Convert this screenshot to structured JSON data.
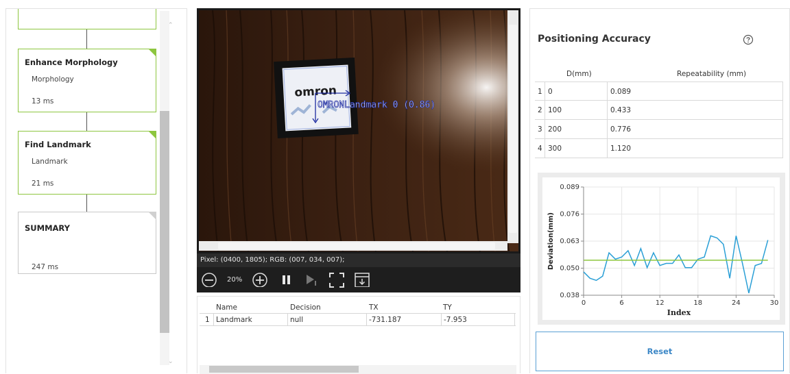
{
  "flow": {
    "cards": [
      {
        "title": "",
        "sub": "",
        "time": ""
      },
      {
        "title": "Enhance Morphology",
        "sub": "Morphology",
        "time": "13 ms"
      },
      {
        "title": "Find Landmark",
        "sub": "Landmark",
        "time": "21 ms"
      },
      {
        "title": "SUMMARY",
        "sub": "",
        "time": "247 ms"
      }
    ]
  },
  "viewer": {
    "logo_text": "omron",
    "overlay_label": "OMRONLandmark 0 (0.86)",
    "pixel_info": "Pixel: (0400, 1805); RGB: (007, 034, 007);",
    "zoom": "20%"
  },
  "results": {
    "headers": [
      "Name",
      "Decision",
      "TX",
      "TY"
    ],
    "rows": [
      {
        "index": "1",
        "name": "Landmark",
        "decision": "null",
        "tx": "-731.187",
        "ty": "-7.953"
      }
    ]
  },
  "accuracy": {
    "title": "Positioning Accuracy",
    "col_d": "D(mm)",
    "col_rep": "Repeatability (mm)",
    "rows": [
      {
        "index": "1",
        "d": "0",
        "rep": "0.089"
      },
      {
        "index": "2",
        "d": "100",
        "rep": "0.433"
      },
      {
        "index": "3",
        "d": "200",
        "rep": "0.776"
      },
      {
        "index": "4",
        "d": "300",
        "rep": "1.120"
      }
    ]
  },
  "chart_data": {
    "type": "line",
    "title": "",
    "xlabel": "Index",
    "ylabel": "Deviation(mm)",
    "xlim": [
      0,
      30
    ],
    "ylim": [
      0.038,
      0.089
    ],
    "xticks": [
      0,
      6,
      12,
      18,
      24,
      30
    ],
    "yticks": [
      "0.089",
      "0.076",
      "0.063",
      "0.050",
      "0.038"
    ],
    "series": [
      {
        "color": "#2a9fd6",
        "x": [
          0,
          1,
          2,
          3,
          4,
          5,
          6,
          7,
          8,
          9,
          10,
          11,
          12,
          13,
          14,
          15,
          16,
          17,
          18,
          19,
          20,
          21,
          22,
          23,
          24,
          25,
          26,
          27,
          28,
          29
        ],
        "y": [
          0.049,
          0.046,
          0.045,
          0.047,
          0.058,
          0.055,
          0.056,
          0.059,
          0.052,
          0.06,
          0.051,
          0.058,
          0.052,
          0.053,
          0.053,
          0.057,
          0.051,
          0.051,
          0.055,
          0.056,
          0.066,
          0.065,
          0.062,
          0.046,
          0.066,
          0.053,
          0.039,
          0.052,
          0.053,
          0.064
        ]
      },
      {
        "color": "#8dc63f",
        "x": [
          0,
          29
        ],
        "y": [
          0.0545,
          0.0545
        ]
      }
    ]
  },
  "reset_label": "Reset",
  "colors": {
    "accent_green": "#8dc63f",
    "accent_blue": "#3d88c7",
    "series_blue": "#2a9fd6"
  }
}
